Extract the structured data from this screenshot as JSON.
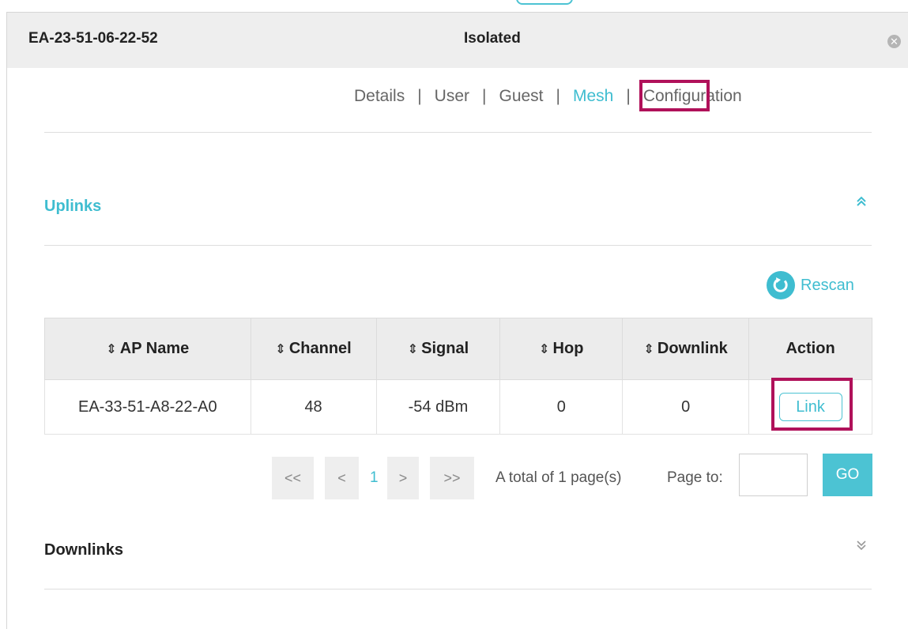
{
  "header": {
    "device_name": "EA-23-51-06-22-52",
    "status": "Isolated",
    "close_icon": "close-circle-icon"
  },
  "tabs": [
    {
      "label": "Details"
    },
    {
      "label": "User"
    },
    {
      "label": "Guest"
    },
    {
      "label": "Mesh",
      "active": true
    },
    {
      "label": "Configuration"
    }
  ],
  "tab_separator": "|",
  "uplinks": {
    "title": "Uplinks",
    "collapse_icon": "double-chevron-up-icon",
    "rescan_label": "Rescan",
    "rescan_icon": "refresh-icon",
    "columns": [
      "AP Name",
      "Channel",
      "Signal",
      "Hop",
      "Downlink",
      "Action"
    ],
    "sortable_icon": "sort-icon",
    "rows": [
      {
        "ap_name": "EA-33-51-A8-22-A0",
        "channel": "48",
        "signal": "-54 dBm",
        "hop": "0",
        "downlink": "0",
        "action": "Link"
      }
    ],
    "pagination": {
      "first": "<<",
      "prev": "<",
      "current_page": "1",
      "next": ">",
      "last": ">>",
      "total_text": "A total of 1 page(s)",
      "page_to_label": "Page to:",
      "page_input_value": "",
      "go_label": "GO"
    }
  },
  "downlinks": {
    "title": "Downlinks",
    "expand_icon": "double-chevron-down-icon"
  },
  "colors": {
    "accent": "#3fbdd0",
    "highlight_box": "#b0115a",
    "header_bg": "#eeeeee"
  }
}
